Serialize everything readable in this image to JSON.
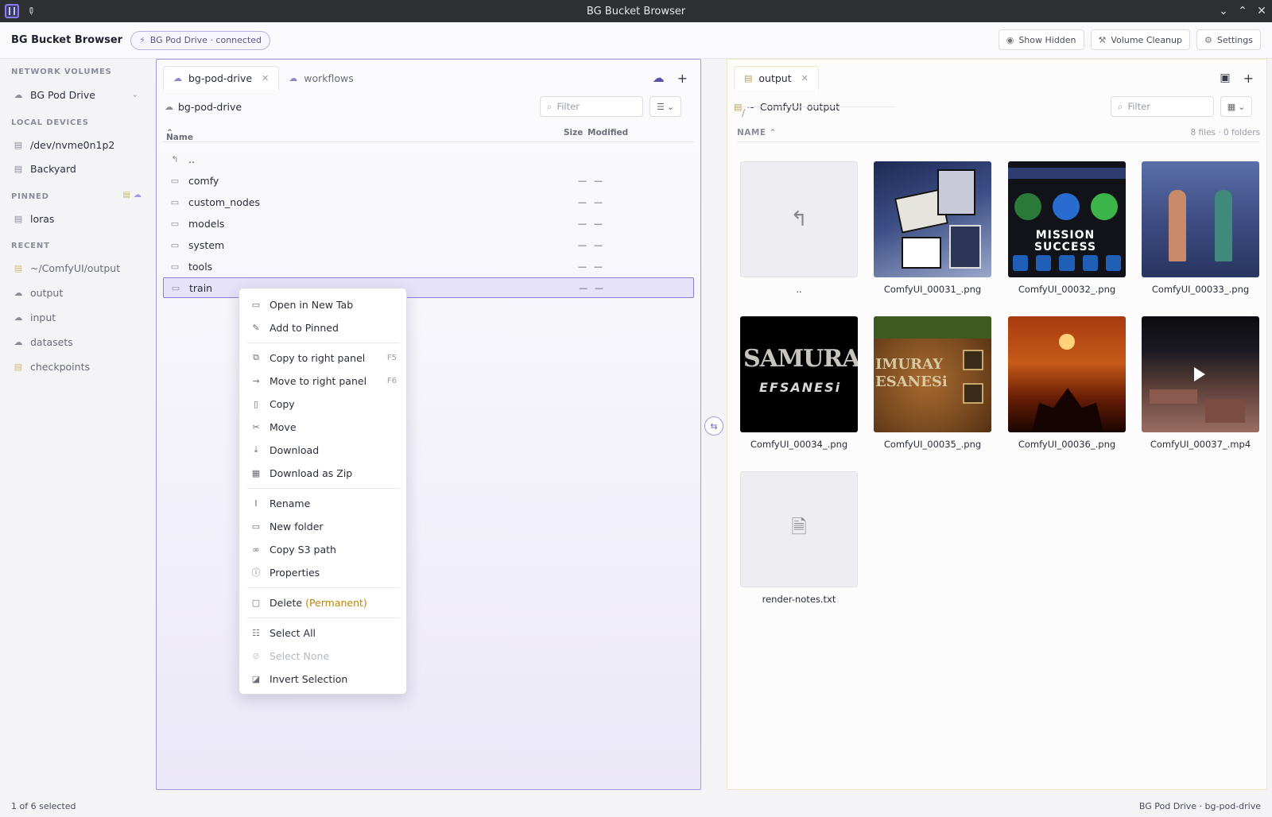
{
  "window": {
    "title": "BG Bucket Browser"
  },
  "header": {
    "brand": "BG Bucket Browser",
    "connection": "BG Pod Drive · connected",
    "actions": {
      "show_hidden": "Show Hidden",
      "volume_cleanup": "Volume Cleanup",
      "settings": "Settings"
    }
  },
  "sidebar": {
    "network_heading": "NETWORK VOLUMES",
    "network_volume": "BG Pod Drive",
    "local_heading": "LOCAL DEVICES",
    "local_devices": [
      "/dev/nvme0n1p2",
      "Backyard"
    ],
    "pinned_heading": "PINNED",
    "pinned": [
      "loras"
    ],
    "recent_heading": "RECENT",
    "recent": [
      "~/ComfyUI/output",
      "output",
      "input",
      "datasets",
      "checkpoints"
    ]
  },
  "left_panel": {
    "tabs": [
      {
        "label": "bg-pod-drive"
      },
      {
        "label": "workflows"
      }
    ],
    "path": "bg-pod-drive",
    "filter_placeholder": "Filter",
    "columns": {
      "name": "Name",
      "size": "Size",
      "modified": "Modified"
    },
    "up": "..",
    "rows": [
      {
        "name": "comfy",
        "size": "—",
        "modified": "—"
      },
      {
        "name": "custom_nodes",
        "size": "—",
        "modified": "—"
      },
      {
        "name": "models",
        "size": "—",
        "modified": "—"
      },
      {
        "name": "system",
        "size": "—",
        "modified": "—"
      },
      {
        "name": "tools",
        "size": "—",
        "modified": "—"
      },
      {
        "name": "train",
        "size": "—",
        "modified": "—"
      }
    ]
  },
  "context_menu": {
    "open_new_tab": "Open in New Tab",
    "add_pinned": "Add to Pinned",
    "copy_right": "Copy to right panel",
    "copy_right_key": "F5",
    "move_right": "Move to right panel",
    "move_right_key": "F6",
    "copy": "Copy",
    "move": "Move",
    "download": "Download",
    "download_zip": "Download as Zip",
    "rename": "Rename",
    "new_folder": "New folder",
    "copy_s3": "Copy S3 path",
    "properties": "Properties",
    "delete": "Delete",
    "delete_note": "(Permanent)",
    "select_all": "Select All",
    "select_none": "Select None",
    "invert": "Invert Selection"
  },
  "right_panel": {
    "tab": "output",
    "crumbs": {
      "home": "~",
      "dir1": "ComfyUI",
      "dir2": "output"
    },
    "filter_placeholder": "Filter",
    "name_col": "NAME",
    "count": "8 files · 0 folders",
    "tiles": {
      "up": "..",
      "f31": "ComfyUI_00031_.png",
      "f32": "ComfyUI_00032_.png",
      "f33": "ComfyUI_00033_.png",
      "f34": "ComfyUI_00034_.png",
      "f35": "ComfyUI_00035_.png",
      "f36": "ComfyUI_00036_.png",
      "f37": "ComfyUI_00037_.mp4",
      "notes": "render-notes.txt"
    },
    "thumb_text": {
      "t32_line1": "MISSION",
      "t32_line2": "SUCCESS",
      "t34_big": "SAMURAY",
      "t34_small": "EFSANESi",
      "t35_text": "IMURAY ESANESi"
    }
  },
  "statusbar": {
    "left": "1 of 6 selected",
    "right": "BG Pod Drive · bg-pod-drive"
  }
}
